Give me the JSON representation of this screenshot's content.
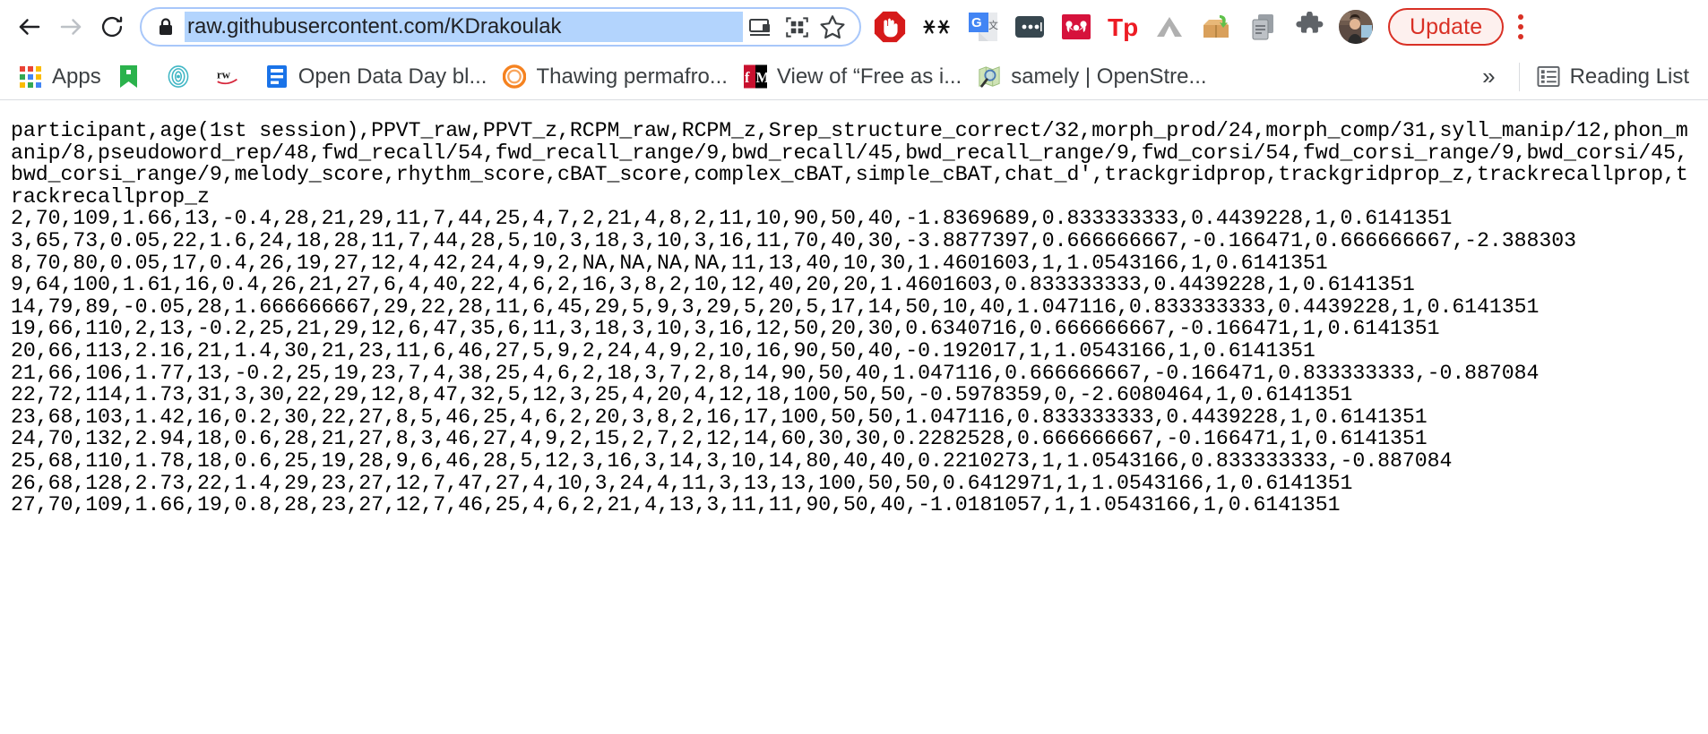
{
  "browser": {
    "nav": {
      "back_icon": "arrow-left-icon",
      "forward_icon": "arrow-right-icon",
      "reload_icon": "reload-icon"
    },
    "omnibox": {
      "lock_icon": "lock-icon",
      "url": "raw.githubusercontent.com/KDrakoulak",
      "url_selected": true,
      "cast_icon": "cast-icon",
      "qr_icon": "qr-code-icon",
      "bookmark_icon": "star-icon"
    },
    "extensions": [
      {
        "name": "adblock-extension-icon",
        "label": "AdBlock"
      },
      {
        "name": "asterisk-extension-icon",
        "label": "Asterisk"
      },
      {
        "name": "google-translate-extension-icon",
        "label": "Google Translate"
      },
      {
        "name": "dots-extension-icon",
        "label": "Dots"
      },
      {
        "name": "mendeley-extension-icon",
        "label": "Mendeley"
      },
      {
        "name": "typio-extension-icon",
        "label": "Tp"
      },
      {
        "name": "nordvpn-extension-icon",
        "label": "NordVPN"
      },
      {
        "name": "unpacked-extension-icon",
        "label": "Unpackage"
      },
      {
        "name": "copy-documents-extension-icon",
        "label": "Copy"
      },
      {
        "name": "puzzle-extensions-icon",
        "label": "Extensions"
      }
    ],
    "profile": {
      "name": "profile-avatar",
      "label": "Profile"
    },
    "update": {
      "label": "Update"
    },
    "menu": {
      "name": "browser-menu-icon",
      "label": "Customize and control"
    }
  },
  "bookmarks": {
    "apps": {
      "icon": "apps-grid-icon",
      "label": "Apps"
    },
    "items": [
      {
        "icon": "green-bookmark-icon",
        "label": ""
      },
      {
        "icon": "teal-spiral-bookmark-icon",
        "label": ""
      },
      {
        "icon": "rw-bookmark-icon",
        "label": ""
      },
      {
        "icon": "blue-doc-bookmark-icon",
        "label": "Open Data Day bl..."
      },
      {
        "icon": "orange-ring-bookmark-icon",
        "label": "Thawing permafro..."
      },
      {
        "icon": "fm-bookmark-icon",
        "label": "View of “Free as i..."
      },
      {
        "icon": "map-magnifier-bookmark-icon",
        "label": "samely | OpenStre..."
      }
    ],
    "overflow_label": "»",
    "reading_list": {
      "icon": "reading-list-icon",
      "label": "Reading List"
    }
  },
  "page": {
    "content_type": "text/plain csv",
    "csv_text": "participant,age(1st session),PPVT_raw,PPVT_z,RCPM_raw,RCPM_z,Srep_structure_correct/32,morph_prod/24,morph_comp/31,syll_manip/12,phon_manip/8,pseudoword_rep/48,fwd_recall/54,fwd_recall_range/9,bwd_recall/45,bwd_recall_range/9,fwd_corsi/54,fwd_corsi_range/9,bwd_corsi/45,bwd_corsi_range/9,melody_score,rhythm_score,cBAT_score,complex_cBAT,simple_cBAT,chat_d',trackgridprop,trackgridprop_z,trackrecallprop,trackrecallprop_z\n2,70,109,1.66,13,-0.4,28,21,29,11,7,44,25,4,7,2,21,4,8,2,11,10,90,50,40,-1.8369689,0.833333333,0.4439228,1,0.6141351\n3,65,73,0.05,22,1.6,24,18,28,11,7,44,28,5,10,3,18,3,10,3,16,11,70,40,30,-3.8877397,0.666666667,-0.166471,0.666666667,-2.388303\n8,70,80,0.05,17,0.4,26,19,27,12,4,42,24,4,9,2,NA,NA,NA,NA,11,13,40,10,30,1.4601603,1,1.0543166,1,0.6141351\n9,64,100,1.61,16,0.4,26,21,27,6,4,40,22,4,6,2,16,3,8,2,10,12,40,20,20,1.4601603,0.833333333,0.4439228,1,0.6141351\n14,79,89,-0.05,28,1.666666667,29,22,28,11,6,45,29,5,9,3,29,5,20,5,17,14,50,10,40,1.047116,0.833333333,0.4439228,1,0.6141351\n19,66,110,2,13,-0.2,25,21,29,12,6,47,35,6,11,3,18,3,10,3,16,12,50,20,30,0.6340716,0.666666667,-0.166471,1,0.6141351\n20,66,113,2.16,21,1.4,30,21,23,11,6,46,27,5,9,2,24,4,9,2,10,16,90,50,40,-0.192017,1,1.0543166,1,0.6141351\n21,66,106,1.77,13,-0.2,25,19,23,7,4,38,25,4,6,2,18,3,7,2,8,14,90,50,40,1.047116,0.666666667,-0.166471,0.833333333,-0.887084\n22,72,114,1.73,31,3,30,22,29,12,8,47,32,5,12,3,25,4,20,4,12,18,100,50,50,-0.5978359,0,-2.6080464,1,0.6141351\n23,68,103,1.42,16,0.2,30,22,27,8,5,46,25,4,6,2,20,3,8,2,16,17,100,50,50,1.047116,0.833333333,0.4439228,1,0.6141351\n24,70,132,2.94,18,0.6,28,21,27,8,3,46,27,4,9,2,15,2,7,2,12,14,60,30,30,0.2282528,0.666666667,-0.166471,1,0.6141351\n25,68,110,1.78,18,0.6,25,19,28,9,6,46,28,5,12,3,16,3,14,3,10,14,80,40,40,0.2210273,1,1.0543166,0.833333333,-0.887084\n26,68,128,2.73,22,1.4,29,23,27,12,7,47,27,4,10,3,24,4,11,3,13,13,100,50,50,0.6412971,1,1.0543166,1,0.6141351\n27,70,109,1.66,19,0.8,28,23,27,12,7,46,25,4,6,2,21,4,13,3,11,11,90,50,40,-1.0181057,1,1.0543166,1,0.6141351"
  }
}
